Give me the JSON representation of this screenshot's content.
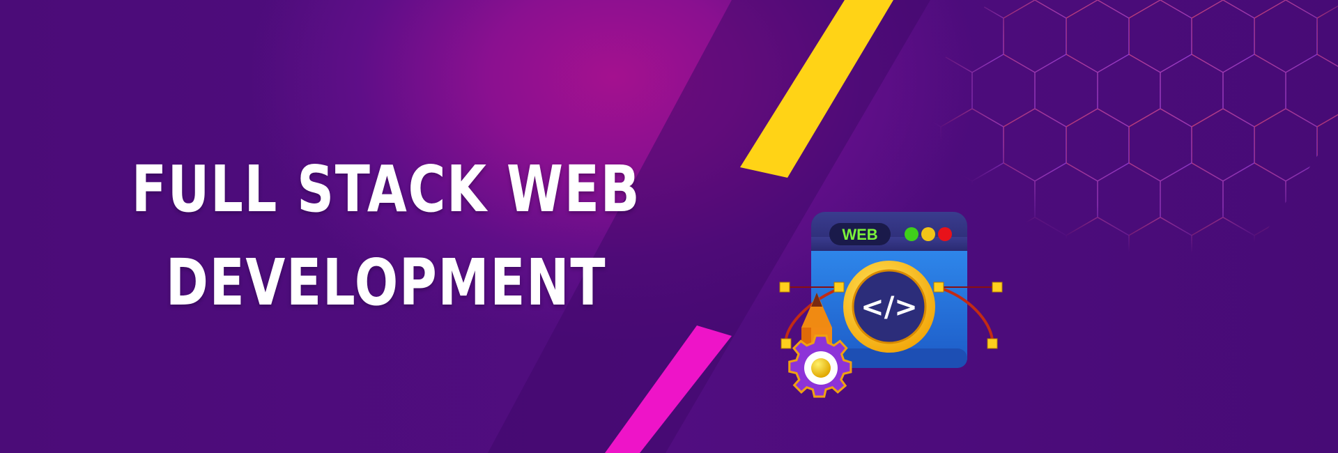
{
  "headline": {
    "line1": "FULL STACK WEB",
    "line2": "DEVELOPMENT"
  },
  "illustration": {
    "window_tag": "WEB",
    "code_symbol": "</>",
    "dot_colors": [
      "#3fcf1a",
      "#f2c418",
      "#e8121a"
    ]
  },
  "colors": {
    "background": "#4a0c77",
    "glow": "#a4118f",
    "yellow_stripe": "#ffd316",
    "pink_stripe": "#ee14c8",
    "hex_pattern_start": "#d8435a",
    "hex_pattern_end": "#8a3df0"
  },
  "icons": [
    "browser-window-icon",
    "code-icon",
    "pen-tool-icon",
    "gear-icon"
  ]
}
